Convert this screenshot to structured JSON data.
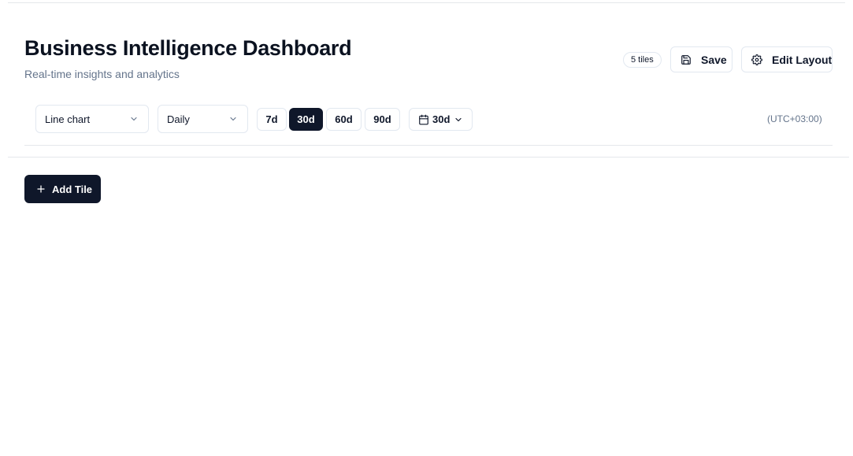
{
  "header": {
    "title": "Business Intelligence Dashboard",
    "subtitle": "Real-time insights and analytics",
    "tiles_badge": "5 tiles",
    "save_label": "Save",
    "edit_layout_label": "Edit Layout"
  },
  "toolbar": {
    "chart_type": "Line chart",
    "granularity": "Daily",
    "ranges": [
      "7d",
      "30d",
      "60d",
      "90d"
    ],
    "active_range": "30d",
    "date_picker_label": "30d",
    "timezone": "(UTC+03:00)"
  },
  "actions": {
    "add_tile_label": "Add Tile"
  },
  "colors": {
    "primary": "#0f172a",
    "muted_text": "#64748b",
    "border": "#e2e8f0"
  },
  "icons": {
    "save": "save-icon",
    "edit_layout": "gear-icon",
    "select": "chevron-down-icon",
    "date_picker": "calendar-icon",
    "add_tile": "plus-icon"
  }
}
